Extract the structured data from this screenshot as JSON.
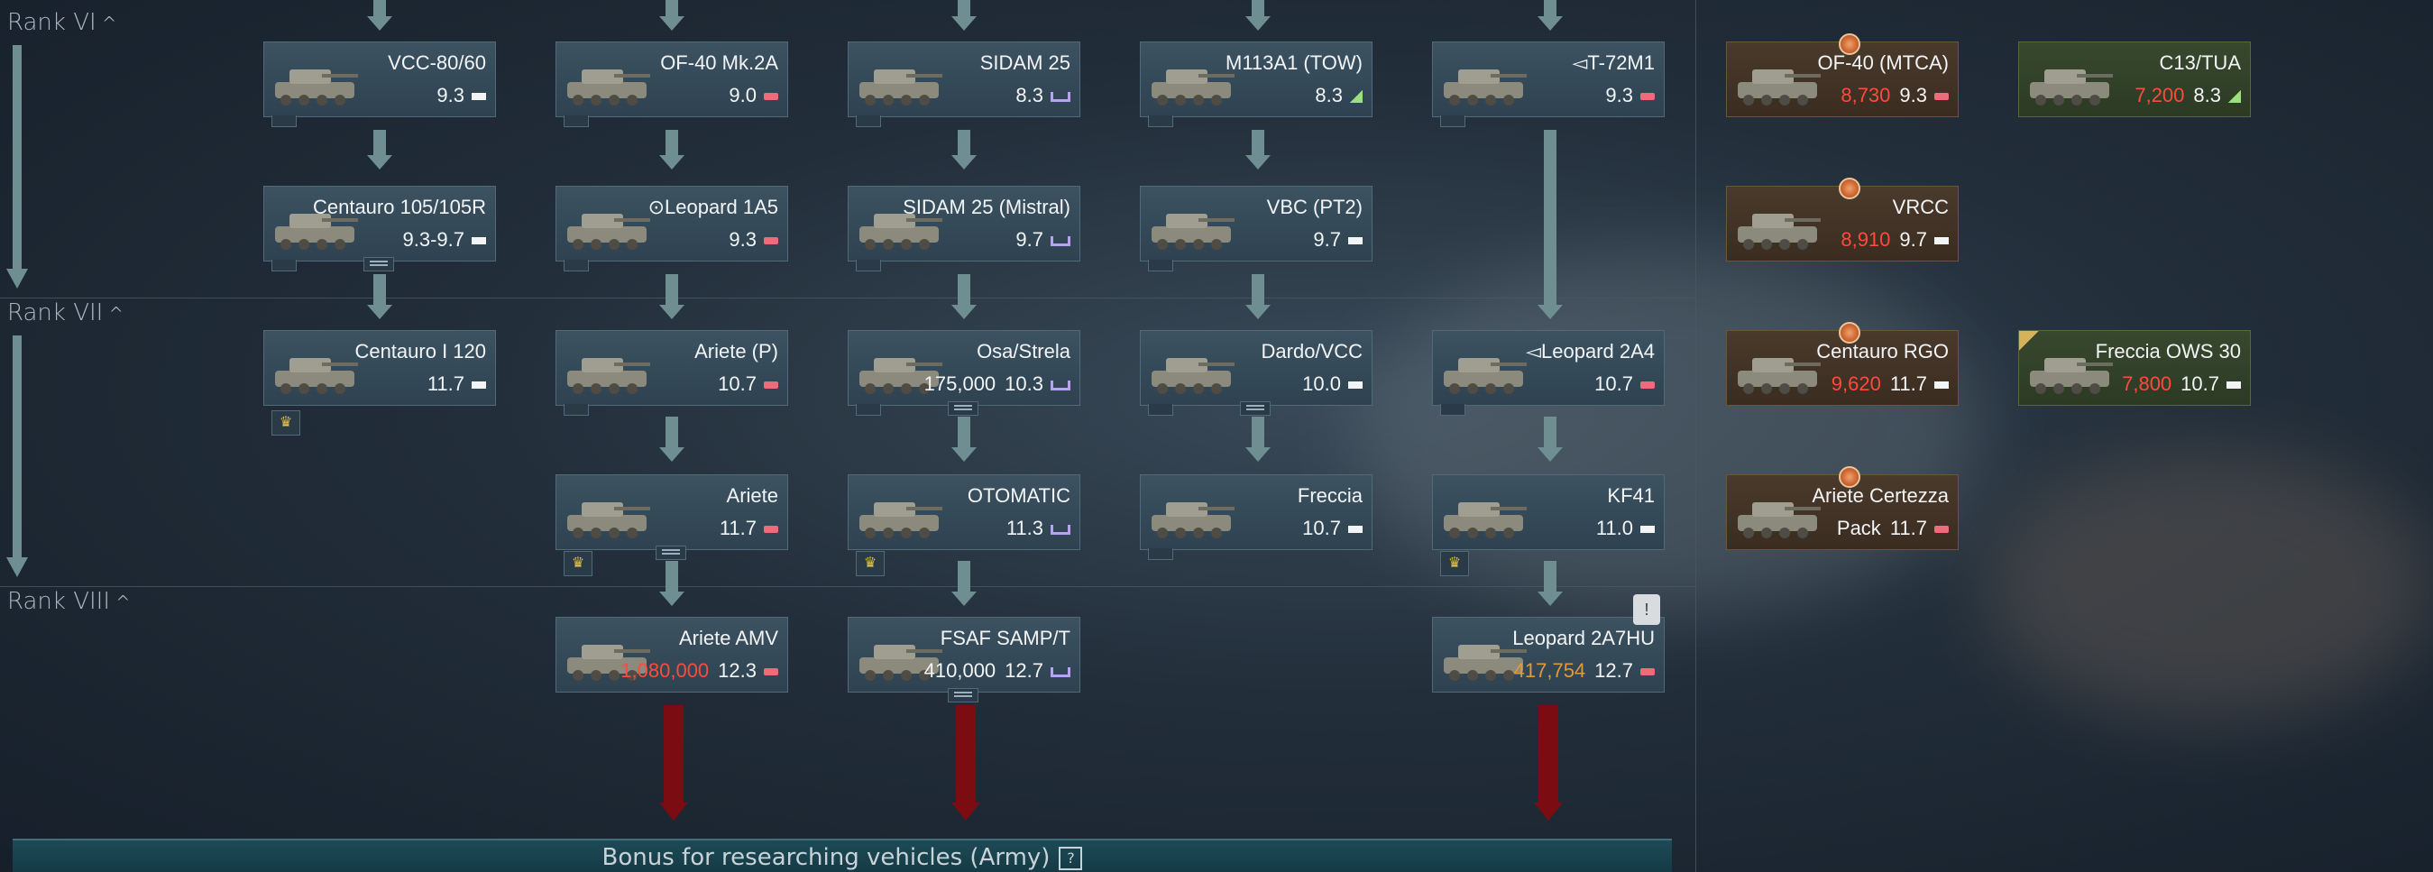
{
  "ranks": [
    {
      "label": "Rank VI",
      "chevron": "^"
    },
    {
      "label": "Rank VII",
      "chevron": "^"
    },
    {
      "label": "Rank VIII",
      "chevron": "^"
    }
  ],
  "bonus": {
    "label": "Bonus for researching vehicles (Army)",
    "help_icon": "?"
  },
  "vehicles": {
    "vcc80": {
      "name": "VCC-80/60",
      "br": "9.3",
      "role": "light"
    },
    "of40mk2a": {
      "name": "OF-40 Mk.2A",
      "br": "9.0",
      "role": "mbt"
    },
    "sidam25": {
      "name": "SIDAM 25",
      "br": "8.3",
      "role": "spaa"
    },
    "m113tow": {
      "name": "M113A1 (TOW)",
      "br": "8.3",
      "role": "td"
    },
    "t72m1": {
      "name": "◅T-72M1",
      "br": "9.3",
      "role": "mbt"
    },
    "of40mtca": {
      "name": "OF-40 (MTCA)",
      "cost": "8,730",
      "br": "9.3",
      "role": "mbt"
    },
    "c13tua": {
      "name": "C13/TUA",
      "cost": "7,200",
      "br": "8.3",
      "role": "td"
    },
    "centauro105": {
      "name": "Centauro 105/105R",
      "br": "9.3-9.7",
      "role": "light"
    },
    "leopard1a5": {
      "name": "⊙Leopard 1A5",
      "br": "9.3",
      "role": "mbt"
    },
    "sidam25mistral": {
      "name": "SIDAM 25 (Mistral)",
      "br": "9.7",
      "role": "spaa"
    },
    "vbcpt2": {
      "name": "VBC (PT2)",
      "br": "9.7",
      "role": "light"
    },
    "vrcc": {
      "name": "VRCC",
      "cost": "8,910",
      "br": "9.7",
      "role": "light"
    },
    "centauro120": {
      "name": "Centauro I 120",
      "br": "11.7",
      "role": "light"
    },
    "arietep": {
      "name": "Ariete (P)",
      "br": "10.7",
      "role": "mbt"
    },
    "osastrela": {
      "name": "Osa/Strela",
      "cost": "175,000",
      "br": "10.3",
      "role": "spaa"
    },
    "dardovcc": {
      "name": "Dardo/VCC",
      "br": "10.0",
      "role": "light"
    },
    "leopard2a4": {
      "name": "◅Leopard 2A4",
      "br": "10.7",
      "role": "mbt"
    },
    "centaurorgo": {
      "name": "Centauro RGO",
      "cost": "9,620",
      "br": "11.7",
      "role": "light"
    },
    "frecciaows30": {
      "name": "Freccia OWS 30",
      "cost": "7,800",
      "br": "10.7",
      "role": "light"
    },
    "ariete": {
      "name": "Ariete",
      "br": "11.7",
      "role": "mbt"
    },
    "otomatic": {
      "name": "OTOMATIC",
      "br": "11.3",
      "role": "spaa"
    },
    "freccia": {
      "name": "Freccia",
      "br": "10.7",
      "role": "light"
    },
    "kf41": {
      "name": "KF41",
      "br": "11.0",
      "role": "light"
    },
    "arietecertezza": {
      "name": "Ariete Certezza",
      "prefix": "Pack",
      "br": "11.7",
      "role": "mbt"
    },
    "arieteamv": {
      "name": "Ariete AMV",
      "cost": "1,080,000",
      "br": "12.3",
      "role": "mbt"
    },
    "fsafsampt": {
      "name": "FSAF SAMP/T",
      "cost": "410,000",
      "br": "12.7",
      "role": "spaa"
    },
    "leopard2a7hu": {
      "name": "Leopard 2A7HU",
      "cost": "417,754",
      "br": "12.7",
      "role": "mbt"
    }
  },
  "colors": {
    "premium_cost": "#ff4a3c",
    "partial_cost": "#e09a3a",
    "link": "#6f8e92",
    "next_rank_link": "#7a0c12",
    "bonus_bar": "#1d4a56"
  }
}
